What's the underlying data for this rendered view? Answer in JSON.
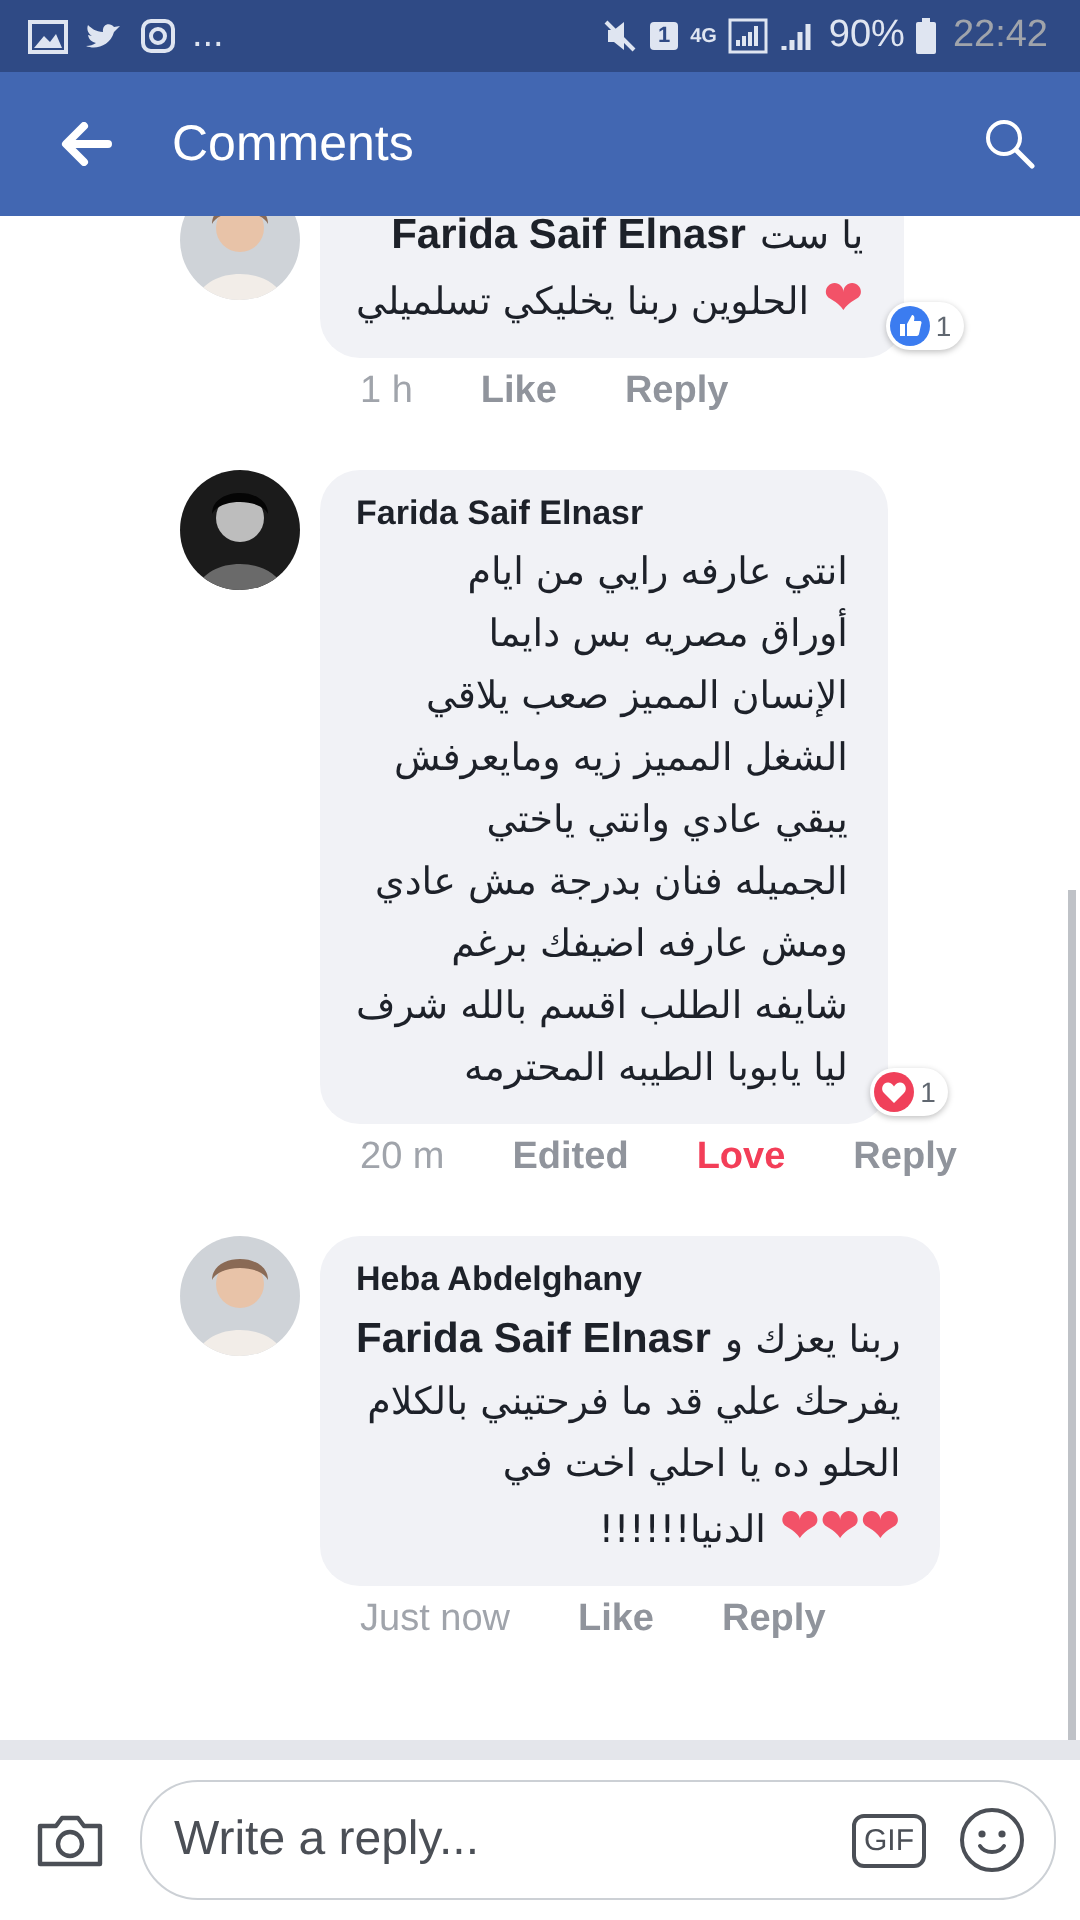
{
  "status_bar": {
    "more": "...",
    "sim": "1",
    "network": "4G",
    "battery": "90%",
    "time": "22:42"
  },
  "header": {
    "title": "Comments"
  },
  "comments": [
    {
      "lines": [
        [
          {
            "kind": "text",
            "text": "يا ست"
          },
          {
            "kind": "mention",
            "text": "Farida Saif Elnasr"
          }
        ],
        [
          {
            "kind": "emoji",
            "text": "❤"
          },
          {
            "kind": "text",
            "text": "الحلوين ربنا يخليكي تسلميلي"
          }
        ]
      ],
      "reaction": {
        "kind": "like",
        "count": "1"
      },
      "time": "1 h",
      "react_button": {
        "label": "Like",
        "selected": false
      },
      "reply_button": "Reply"
    },
    {
      "author": "Farida Saif Elnasr",
      "lines": [
        [
          {
            "kind": "text",
            "text": "انتي عارفه رايي  من ايام"
          }
        ],
        [
          {
            "kind": "text",
            "text": "أوراق مصريه بس دايما"
          }
        ],
        [
          {
            "kind": "text",
            "text": "الإنسان المميز صعب يلاقي"
          }
        ],
        [
          {
            "kind": "text",
            "text": "الشغل المميز زيه ومايعرفش"
          }
        ],
        [
          {
            "kind": "text",
            "text": "يبقي عادي وانتي ياختي"
          }
        ],
        [
          {
            "kind": "text",
            "text": "الجميله فنان بدرجة مش عادي"
          }
        ],
        [
          {
            "kind": "text",
            "text": "ومش عارفه اضيفك برغم"
          }
        ],
        [
          {
            "kind": "text",
            "text": "شايفه الطلب اقسم بالله شرف"
          }
        ],
        [
          {
            "kind": "text",
            "text": "ليا يابوبا الطيبه المحترمه"
          }
        ]
      ],
      "reaction": {
        "kind": "love",
        "count": "1"
      },
      "time": "20 m",
      "edited": "Edited",
      "react_button": {
        "label": "Love",
        "selected": true
      },
      "reply_button": "Reply"
    },
    {
      "author": "Heba Abdelghany",
      "lines": [
        [
          {
            "kind": "text",
            "text": "ربنا يعزك و"
          },
          {
            "kind": "mention",
            "text": "Farida Saif Elnasr"
          }
        ],
        [
          {
            "kind": "text",
            "text": "يفرحك علي قد ما فرحتيني بالكلام"
          }
        ],
        [
          {
            "kind": "text",
            "text": "الحلو ده يا احلي اخت في"
          }
        ],
        [
          {
            "kind": "emoji",
            "text": "❤❤❤"
          },
          {
            "kind": "text",
            "text": "الدنيا!!!!!!"
          }
        ]
      ],
      "time": "Just now",
      "react_button": {
        "label": "Like",
        "selected": false
      },
      "reply_button": "Reply"
    }
  ],
  "composer": {
    "placeholder": "Write a reply...",
    "gif": "GIF"
  }
}
